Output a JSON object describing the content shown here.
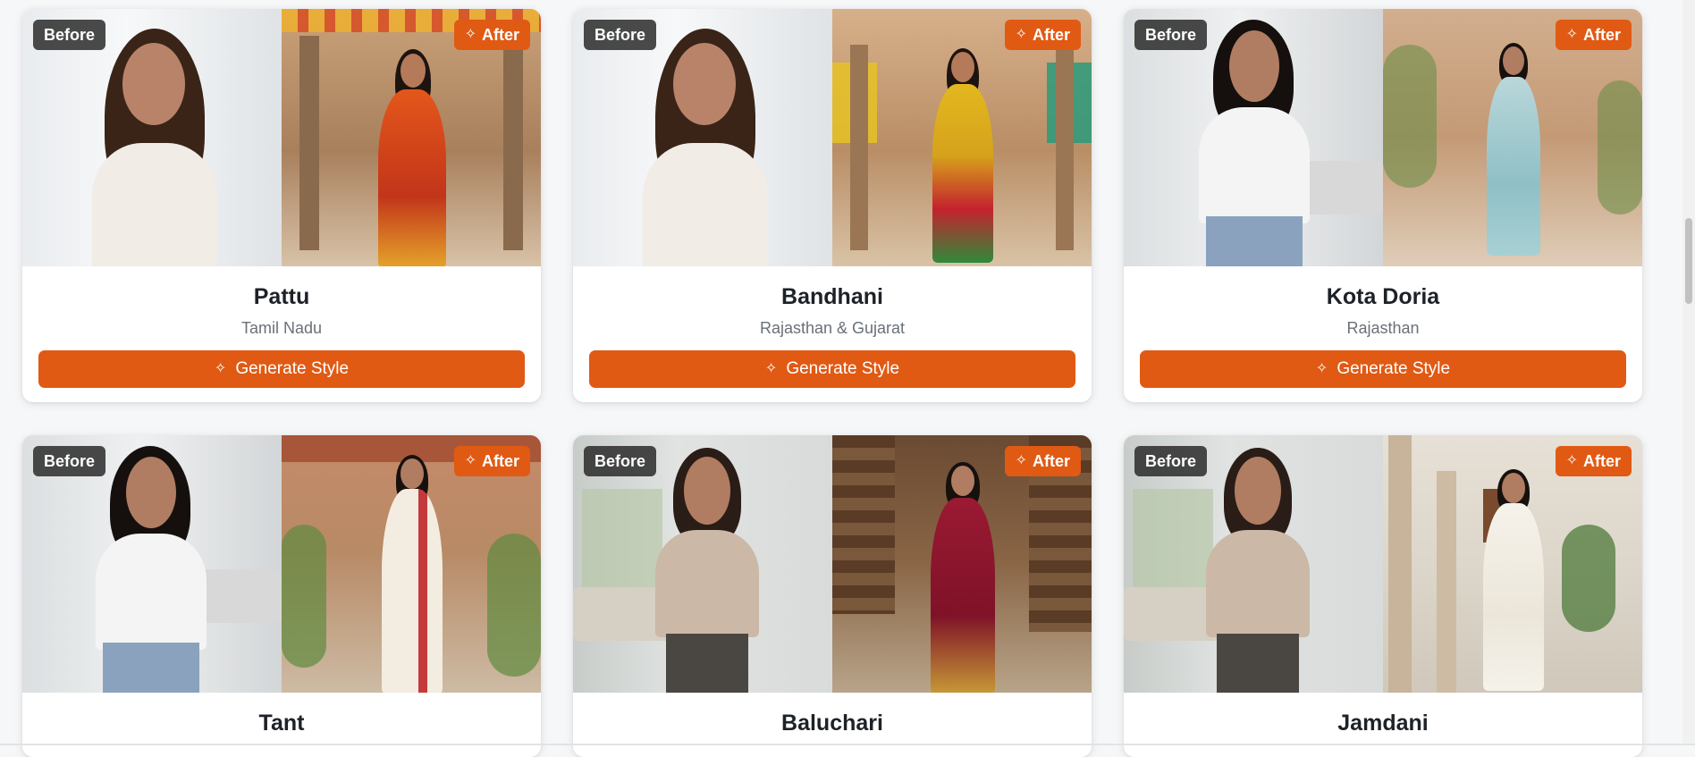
{
  "badges": {
    "before": "Before",
    "after": "After"
  },
  "button_label": "Generate Style",
  "colors": {
    "accent": "#e05a14",
    "badge_dark": "#2a2a2a"
  },
  "cards": [
    {
      "title": "Pattu",
      "region": "Tamil Nadu"
    },
    {
      "title": "Bandhani",
      "region": "Rajasthan & Gujarat"
    },
    {
      "title": "Kota Doria",
      "region": "Rajasthan"
    },
    {
      "title": "Tant",
      "region": ""
    },
    {
      "title": "Baluchari",
      "region": ""
    },
    {
      "title": "Jamdani",
      "region": ""
    }
  ]
}
